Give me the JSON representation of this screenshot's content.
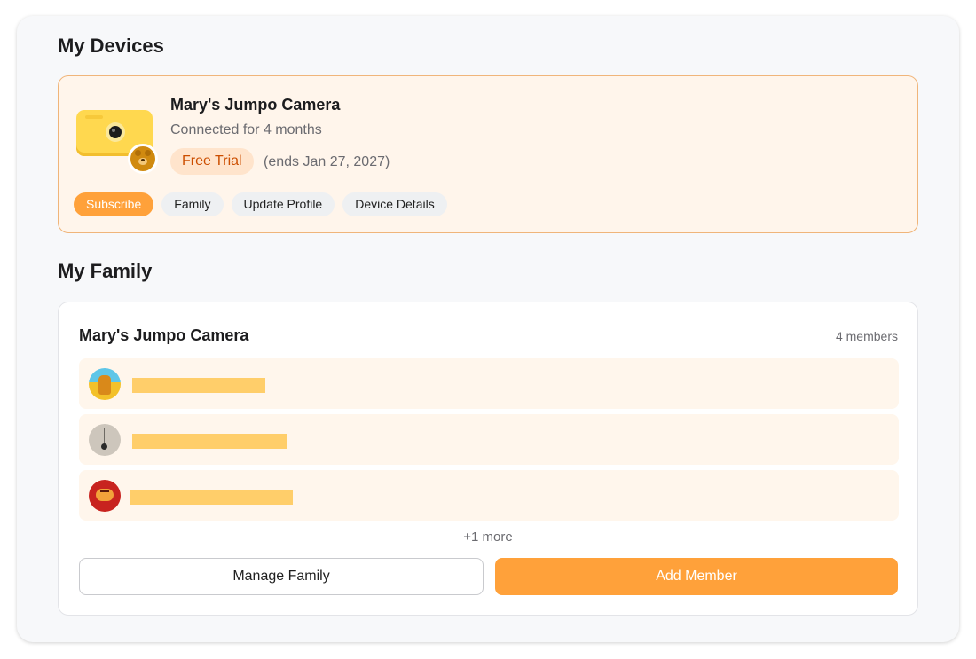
{
  "devices": {
    "title": "My Devices",
    "device": {
      "name": "Mary's Jumpo Camera",
      "connected": "Connected for 4 months",
      "plan_badge": "Free Trial",
      "plan_ends": "(ends Jan 27, 2027)",
      "device_icon": "camera-icon",
      "profile_icon": "bear-avatar"
    },
    "actions": {
      "subscribe": "Subscribe",
      "family": "Family",
      "update_profile": "Update Profile",
      "device_details": "Device Details"
    }
  },
  "family": {
    "title": "My Family",
    "group_name": "Mary's Jumpo Camera",
    "member_count": "4 members",
    "members": [
      {
        "avatar": "hand-avatar",
        "name_redacted": true
      },
      {
        "avatar": "pendulum-avatar",
        "name_redacted": true
      },
      {
        "avatar": "tiger-avatar",
        "name_redacted": true
      }
    ],
    "more": "+1 more",
    "manage_label": "Manage Family",
    "add_label": "Add Member"
  },
  "colors": {
    "accent": "#ffa13a",
    "card_highlight": "#fff5eb",
    "trial_text": "#cc4e00",
    "redaction": "#ffce6a"
  }
}
